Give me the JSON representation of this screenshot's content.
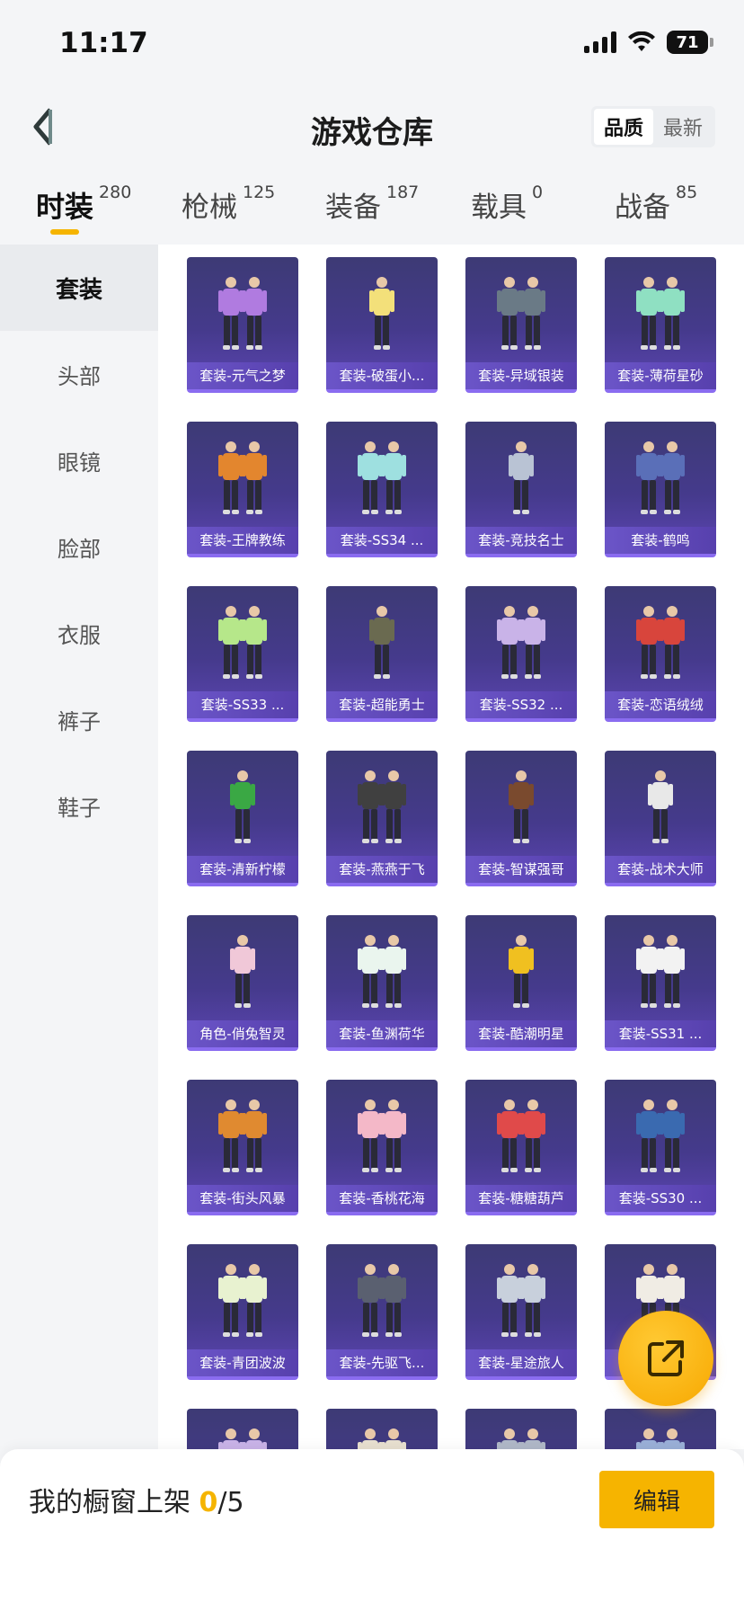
{
  "status_bar": {
    "time": "11:17",
    "battery": "71"
  },
  "header": {
    "title": "游戏仓库",
    "sort_options": [
      "品质",
      "最新"
    ],
    "sort_active": "品质"
  },
  "tabs": [
    {
      "label": "时装",
      "count": "280",
      "active": true
    },
    {
      "label": "枪械",
      "count": "125",
      "active": false
    },
    {
      "label": "装备",
      "count": "187",
      "active": false
    },
    {
      "label": "载具",
      "count": "0",
      "active": false
    },
    {
      "label": "战备",
      "count": "85",
      "active": false
    }
  ],
  "categories": [
    {
      "label": "套装",
      "active": true
    },
    {
      "label": "头部",
      "active": false
    },
    {
      "label": "眼镜",
      "active": false
    },
    {
      "label": "脸部",
      "active": false
    },
    {
      "label": "衣服",
      "active": false
    },
    {
      "label": "裤子",
      "active": false
    },
    {
      "label": "鞋子",
      "active": false
    }
  ],
  "items": [
    {
      "label": "套装-元气之梦",
      "icon": "outfit-pair-purple-icon",
      "color": "#b07be0"
    },
    {
      "label": "套装-破蛋小...",
      "icon": "outfit-egg-chick-icon",
      "color": "#f3e07a"
    },
    {
      "label": "套装-异域银装",
      "icon": "outfit-pair-dark-icon",
      "color": "#6a7a86"
    },
    {
      "label": "套装-薄荷星砂",
      "icon": "outfit-pair-mint-icon",
      "color": "#8fe0c2"
    },
    {
      "label": "套装-王牌教练",
      "icon": "outfit-pair-orange-icon",
      "color": "#e3862e"
    },
    {
      "label": "套装-SS34 ...",
      "icon": "outfit-pair-teal-icon",
      "color": "#9ee0e0"
    },
    {
      "label": "套装-竞技名士",
      "icon": "outfit-jacket-grey-icon",
      "color": "#b9c3d4"
    },
    {
      "label": "套装-鹤鸣",
      "icon": "outfit-pair-blue-icon",
      "color": "#5a6fb8"
    },
    {
      "label": "套装-SS33 ...",
      "icon": "outfit-pair-green-icon",
      "color": "#b6e78a"
    },
    {
      "label": "套装-超能勇士",
      "icon": "outfit-vest-olive-icon",
      "color": "#6a6a50"
    },
    {
      "label": "套装-SS32 ...",
      "icon": "outfit-pair-lavender-icon",
      "color": "#c9b3e8"
    },
    {
      "label": "套装-恋语绒绒",
      "icon": "outfit-pair-red-icon",
      "color": "#d8453c"
    },
    {
      "label": "套装-清新柠檬",
      "icon": "outfit-green-jacket-icon",
      "color": "#3aa844"
    },
    {
      "label": "套装-燕燕于飞",
      "icon": "outfit-pair-black-icon",
      "color": "#404040"
    },
    {
      "label": "套装-智谋强哥",
      "icon": "outfit-single-brown-icon",
      "color": "#7a4a2e"
    },
    {
      "label": "套装-战术大师",
      "icon": "outfit-single-white-icon",
      "color": "#e8e8e8"
    },
    {
      "label": "角色-俏兔智灵",
      "icon": "character-bunny-icon",
      "color": "#f0c8d8"
    },
    {
      "label": "套装-鱼渊荷华",
      "icon": "outfit-pair-white-icon",
      "color": "#eaf5ee"
    },
    {
      "label": "套装-酷潮明星",
      "icon": "outfit-yellow-jacket-icon",
      "color": "#f0c020"
    },
    {
      "label": "套装-SS31 ...",
      "icon": "outfit-pair-white-red-icon",
      "color": "#f2f2f2"
    },
    {
      "label": "套装-街头风暴",
      "icon": "outfit-pair-navy-orange-icon",
      "color": "#e08a30"
    },
    {
      "label": "套装-香桃花海",
      "icon": "outfit-pair-pink-icon",
      "color": "#f4b8c8"
    },
    {
      "label": "套装-糖糖葫芦",
      "icon": "outfit-pair-white-red2-icon",
      "color": "#e04a4a"
    },
    {
      "label": "套装-SS30 ...",
      "icon": "outfit-pair-blue-gold-icon",
      "color": "#3a6ab0"
    },
    {
      "label": "套装-青团波波",
      "icon": "outfit-pair-cream-icon",
      "color": "#e8f2d0"
    },
    {
      "label": "套装-先驱飞...",
      "icon": "outfit-pair-armor-icon",
      "color": "#5a6070"
    },
    {
      "label": "套装-星途旅人",
      "icon": "outfit-pair-silver-icon",
      "color": "#c8d0dc"
    },
    {
      "label": "套装-...",
      "icon": "outfit-pair-white-icon",
      "color": "#f0ece4"
    },
    {
      "label": "",
      "icon": "outfit-pair-partial-icon",
      "color": "#c9b3e8"
    },
    {
      "label": "",
      "icon": "outfit-pair-partial-icon",
      "color": "#e8e0d0"
    },
    {
      "label": "",
      "icon": "outfit-pair-partial-icon",
      "color": "#b0b8c8"
    },
    {
      "label": "",
      "icon": "outfit-pair-partial-icon",
      "color": "#9ab0d8"
    }
  ],
  "fab": {
    "icon": "share-external-icon"
  },
  "bottom": {
    "shelf_prefix": "我的橱窗上架 ",
    "shelf_current": "0",
    "shelf_total": "/5",
    "edit_label": "编辑"
  }
}
